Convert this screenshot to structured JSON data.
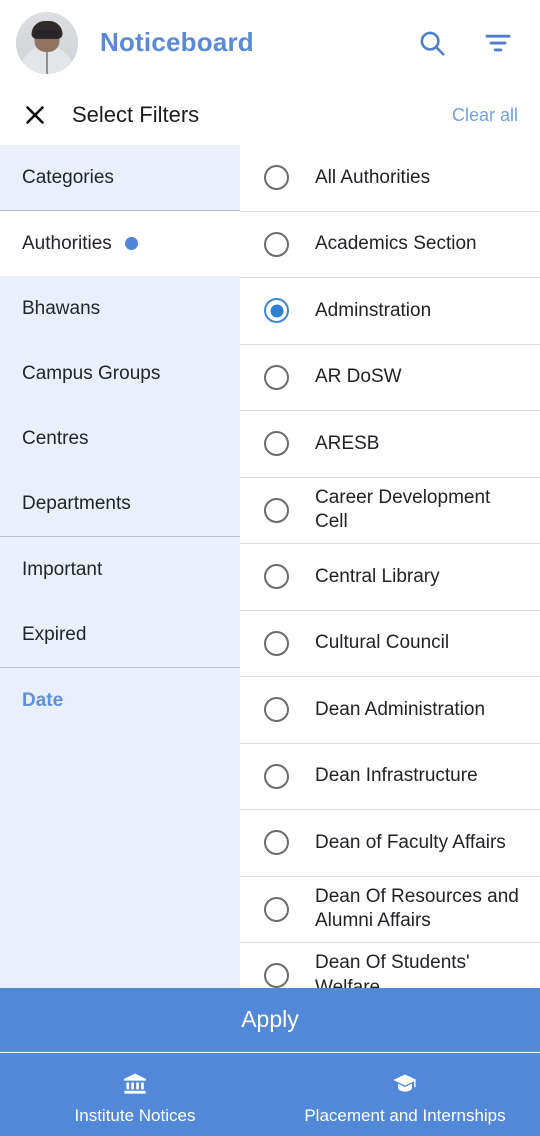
{
  "appbar": {
    "title": "Noticeboard",
    "avatar_name": "user-avatar",
    "search_icon": "search-icon",
    "filter_icon": "filter-icon"
  },
  "filter_header": {
    "close_icon": "close-icon",
    "title": "Select Filters",
    "clear_all_label": "Clear all"
  },
  "sidebar": {
    "groups": [
      {
        "items": [
          {
            "label": "Categories",
            "selected": false,
            "accent": false,
            "dot": false
          }
        ]
      },
      {
        "items": [
          {
            "label": "Authorities",
            "selected": true,
            "accent": false,
            "dot": true
          },
          {
            "label": "Bhawans",
            "selected": false,
            "accent": false,
            "dot": false
          },
          {
            "label": "Campus Groups",
            "selected": false,
            "accent": false,
            "dot": false
          },
          {
            "label": "Centres",
            "selected": false,
            "accent": false,
            "dot": false
          },
          {
            "label": "Departments",
            "selected": false,
            "accent": false,
            "dot": false
          }
        ]
      },
      {
        "items": [
          {
            "label": "Important",
            "selected": false,
            "accent": false,
            "dot": false
          },
          {
            "label": "Expired",
            "selected": false,
            "accent": false,
            "dot": false
          }
        ]
      },
      {
        "items": [
          {
            "label": "Date",
            "selected": false,
            "accent": true,
            "dot": false
          }
        ]
      }
    ]
  },
  "options": {
    "items": [
      {
        "label": "All Authorities",
        "checked": false
      },
      {
        "label": "Academics Section",
        "checked": false
      },
      {
        "label": "Adminstration",
        "checked": true
      },
      {
        "label": "AR DoSW",
        "checked": false
      },
      {
        "label": "ARESB",
        "checked": false
      },
      {
        "label": "Career Development Cell",
        "checked": false
      },
      {
        "label": "Central Library",
        "checked": false
      },
      {
        "label": "Cultural Council",
        "checked": false
      },
      {
        "label": "Dean Administration",
        "checked": false
      },
      {
        "label": "Dean Infrastructure",
        "checked": false
      },
      {
        "label": "Dean of Faculty Affairs",
        "checked": false
      },
      {
        "label": "Dean Of Resources and Alumni Affairs",
        "checked": false
      },
      {
        "label": "Dean Of Students' Welfare",
        "checked": false
      }
    ]
  },
  "apply": {
    "label": "Apply"
  },
  "bottom_nav": {
    "items": [
      {
        "label": "Institute Notices",
        "icon": "institute-icon"
      },
      {
        "label": "Placement and Internships",
        "icon": "graduation-cap-icon"
      }
    ]
  },
  "colors": {
    "accent_blue": "#5288d8",
    "title_blue": "#5a8ad6",
    "sidebar_bg": "#eaf0fb",
    "radio_selected": "#2f7fd4",
    "clear_all": "#74a0e0"
  }
}
